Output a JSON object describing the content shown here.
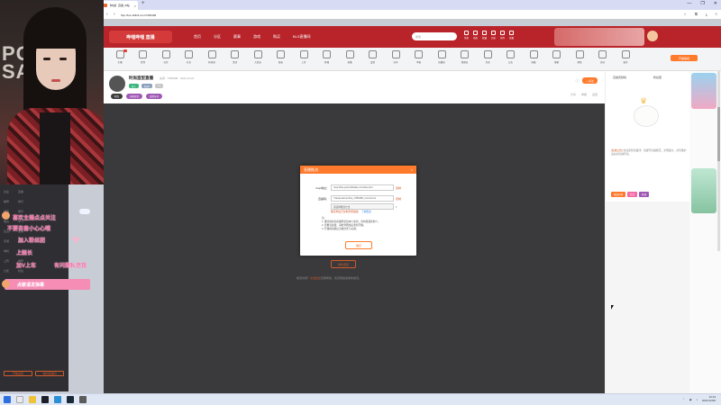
{
  "browser": {
    "tab_title": "【B站】直播_B站",
    "url": "http://live.bilibili.com/7365468",
    "new_tab": "+",
    "window_controls": [
      "—",
      "❐",
      "✕"
    ]
  },
  "cam": {
    "bg_text": "PO\nSA"
  },
  "site_header": {
    "logo_text": "哔哩哔哩 直播",
    "nav": [
      "首页",
      "分区",
      "赛事",
      "游戏",
      "购买",
      "BLS直播间"
    ],
    "search_placeholder": "搜索",
    "icons": [
      "消息",
      "动态",
      "收藏",
      "历史",
      "创作",
      "投稿"
    ]
  },
  "toolbar": {
    "tools": [
      "主播",
      "签到",
      "任务",
      "礼包",
      "粉丝团",
      "活动",
      "大航海",
      "舰长",
      "上传",
      "开播",
      "直播",
      "设置",
      "分享",
      "举报",
      "直播间",
      "管理员",
      "互动",
      "公告",
      "屏蔽",
      "弹幕",
      "帮助",
      "房间",
      "更多"
    ],
    "level_badge": "开播等级"
  },
  "room": {
    "title": "时尚造型直播",
    "meta": "房间 · 7365468 · 2021-12-01",
    "chips": [
      "新人",
      "粉丝7",
      "Lv"
    ],
    "tags": [
      "时尚",
      "穿搭日常",
      "造型分享"
    ],
    "follow": "+ 关注",
    "actions": [
      "分享",
      "举报",
      "设置"
    ]
  },
  "modal": {
    "title": "直播推流",
    "close": "×",
    "server_label": "rtmp地址：",
    "server_value": "rtmp://live-push.bilivideo.com/live-bvc/",
    "key_label": "直播码：",
    "key_value": "?streamname=live_7365468_xxxxxxxxxx",
    "dropdown": "请选择推流方式",
    "copy": "复制",
    "link_text": "推流地址已复制到剪贴板",
    "link_more": "了解更多",
    "notes": [
      "注：",
      "1. 推流地址和直播码仅供本人使用，请勿泄露给他人。",
      "2. 若推流失败，请检查网络后重新开播。",
      "3. 开播前请确认直播分区与标题。"
    ],
    "confirm": "确定"
  },
  "player": {
    "retry_button": "重新连接",
    "hint_prefix": "推流中断？",
    "hint_link": "点击此处",
    "hint_suffix": "查看帮助，检查网络或重新推流。"
  },
  "right_panel": {
    "tabs": [
      "直播贡献榜",
      "粉丝团"
    ],
    "notice_label": "[系统公告]",
    "notice_text": "欢迎来到直播间！请遵守直播规范，文明发言，共同维护良好的直播环境。",
    "gifts": [
      "赠送礼物",
      "打赏",
      "开通"
    ]
  },
  "sidebar": {
    "rows": [
      [
        "关注",
        "直播"
      ],
      [
        "推荐",
        "排行"
      ],
      [
        "游戏",
        "娱乐"
      ],
      [
        "电台",
        "学习"
      ],
      [
        "生活",
        "虚拟"
      ],
      [
        "手游",
        "网游"
      ],
      [
        "单机",
        "更多"
      ],
      [
        "上传",
        "推荐"
      ],
      [
        "分区",
        "标签"
      ]
    ],
    "buttons": [
      "开播设置",
      "我的直播间"
    ]
  },
  "stickers": {
    "lines": [
      "喜欢主播点点关注",
      "不要吝啬小心心哦",
      "加入粉丝团",
      "上舰长",
      "加V上车",
      "有问题私信我"
    ],
    "banner": "点歌请发弹幕"
  },
  "taskbar": {
    "time": "13:13",
    "date": "2021/12/06"
  },
  "colors": {
    "brand_red": "#b8242a",
    "accent_orange": "#ff7a2c",
    "sticker_pink": "#f46aa4"
  }
}
